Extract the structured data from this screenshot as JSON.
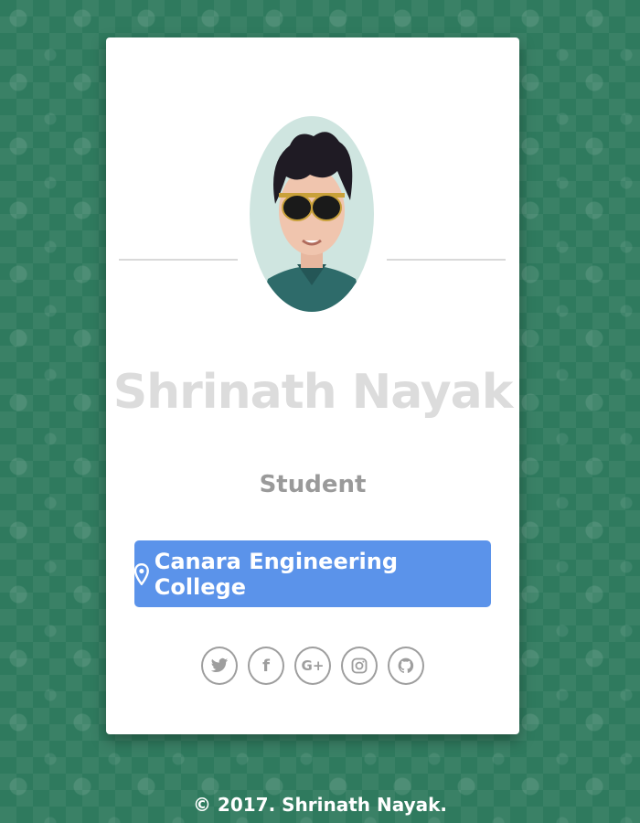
{
  "profile": {
    "name": "Shrinath Nayak",
    "role": "Student",
    "college": "Canara Engineering College",
    "college_icon": "map-marker-icon"
  },
  "social": [
    {
      "name": "twitter",
      "icon": "twitter-icon"
    },
    {
      "name": "facebook",
      "icon": "facebook-icon",
      "glyph": "f"
    },
    {
      "name": "google-plus",
      "icon": "google-plus-icon",
      "glyph": "G+"
    },
    {
      "name": "instagram",
      "icon": "instagram-icon"
    },
    {
      "name": "github",
      "icon": "github-icon"
    }
  ],
  "footer": {
    "text": "© 2017. Shrinath Nayak."
  },
  "colors": {
    "background": "#2f7a5e",
    "card": "#ffffff",
    "accent": "#5b93ea",
    "name_text": "#dcdcdc",
    "role_text": "#9a9a9a",
    "icon": "#9e9e9e"
  }
}
